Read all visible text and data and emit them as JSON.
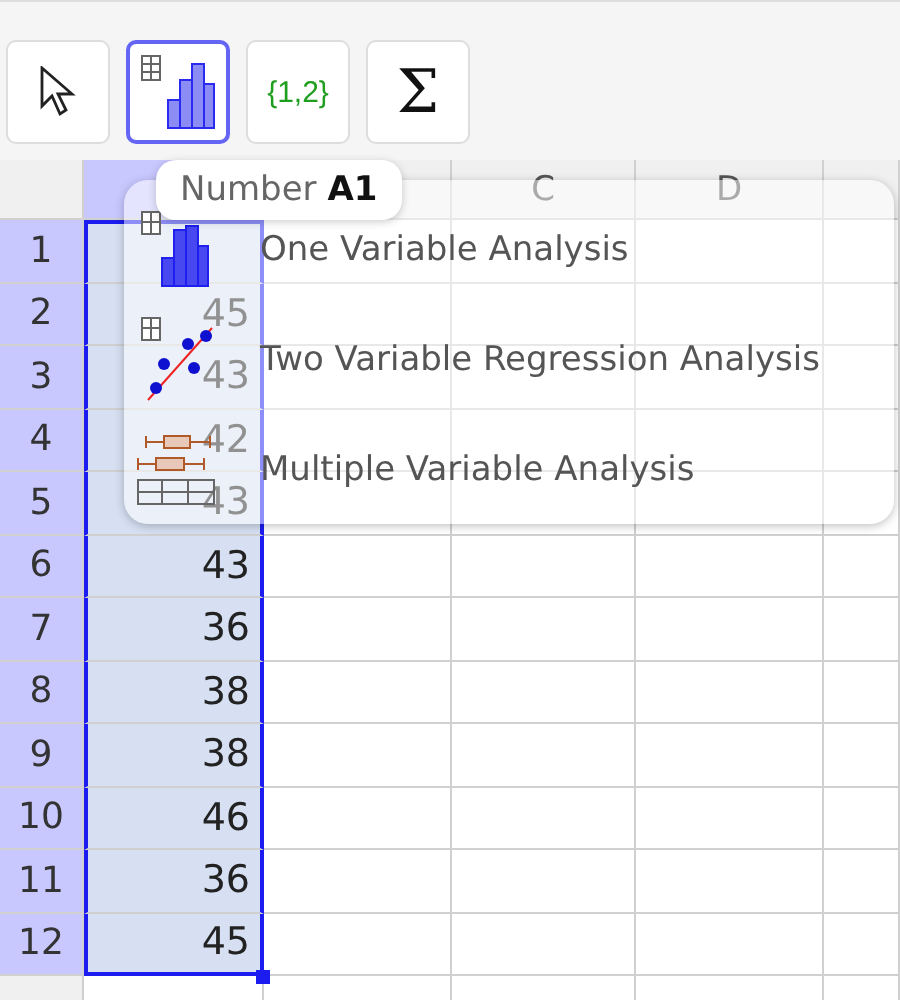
{
  "toolbar": [
    {
      "kind": "pointer",
      "selected": false
    },
    {
      "kind": "analysis",
      "selected": true
    },
    {
      "kind": "text",
      "text": "{1,2}",
      "selected": false
    },
    {
      "kind": "text",
      "text": "Σ",
      "selected": false
    }
  ],
  "columns": [
    {
      "selected": true
    },
    {
      "selected": false
    },
    {
      "label": "C",
      "selected": false
    },
    {
      "label": "D",
      "selected": false
    }
  ],
  "rows": [
    {
      "label": "1",
      "selected": true
    },
    {
      "label": "2",
      "value": "45",
      "selected": true
    },
    {
      "label": "3",
      "value": "43",
      "selected": true
    },
    {
      "label": "4",
      "value": "42",
      "selected": true
    },
    {
      "label": "5",
      "value": "43",
      "selected": true
    },
    {
      "label": "6",
      "value": "43",
      "selected": true
    },
    {
      "label": "7",
      "value": "36",
      "selected": true
    },
    {
      "label": "8",
      "value": "38",
      "selected": true
    },
    {
      "label": "9",
      "value": "38",
      "selected": true
    },
    {
      "label": "10",
      "value": "46",
      "selected": true
    },
    {
      "label": "11",
      "value": "36",
      "selected": true
    },
    {
      "label": "12",
      "value": "45",
      "selected": true
    }
  ],
  "tooltip": "Number **A1**",
  "menu": [
    {
      "kind": "one",
      "label": "One Variable Analysis"
    },
    {
      "kind": "two",
      "label": "Two Variable Regression Analysis"
    },
    {
      "kind": "multi",
      "label": "Multiple Variable Analysis"
    }
  ]
}
